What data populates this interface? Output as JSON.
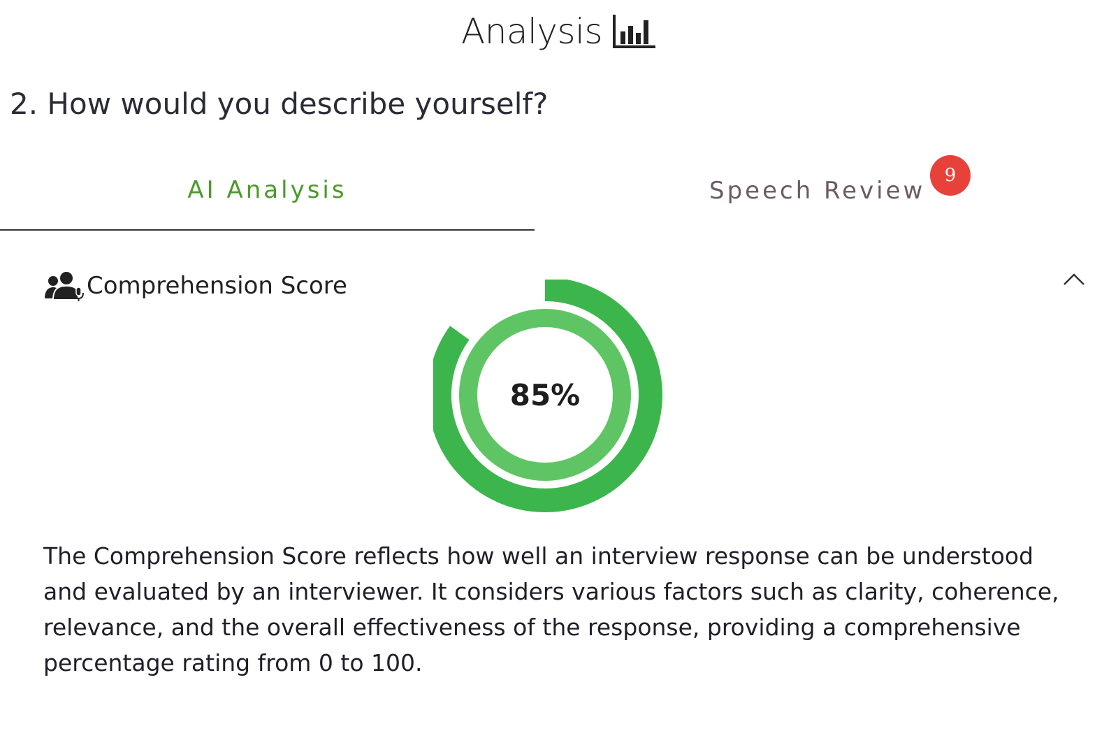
{
  "header": {
    "title": "Analysis",
    "icon": "bar-chart-icon"
  },
  "question": {
    "text": "2. How would you describe yourself?"
  },
  "tabs": [
    {
      "label": "AI Analysis",
      "active": true,
      "color": "#4a9a2a"
    },
    {
      "label": "Speech Review",
      "active": false,
      "badge": "9",
      "badge_color": "#e8413a"
    }
  ],
  "section": {
    "title": "Comprehension Score",
    "icon": "people-mic-icon",
    "collapse_icon": "chevron-up-icon"
  },
  "score": {
    "label": "85%",
    "value": 85,
    "outer_color": "#3cb64c",
    "inner_color": "#5fc564"
  },
  "description": "The Comprehension Score reflects how well an interview response can be understood and evaluated by an interviewer. It considers various factors such as clarity, coherence, relevance, and the overall effectiveness of the response, providing a comprehensive percentage rating from 0 to 100."
}
